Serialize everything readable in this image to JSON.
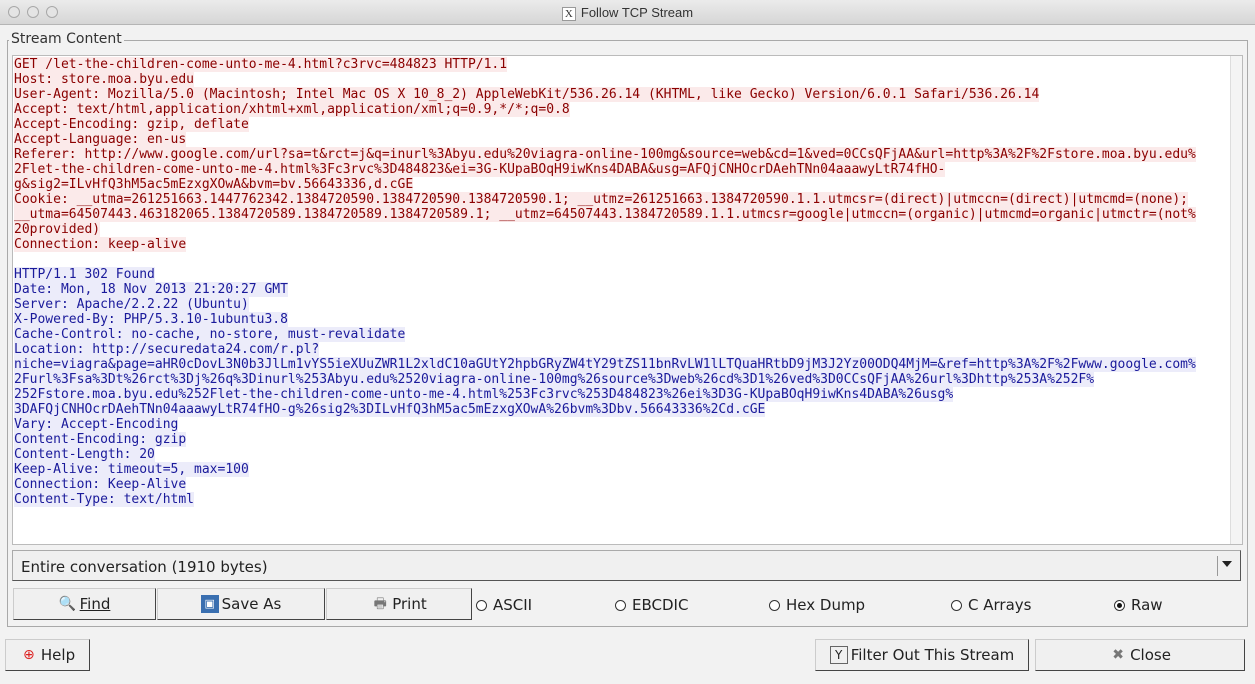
{
  "window": {
    "title": "Follow TCP Stream",
    "title_icon": "X"
  },
  "stream": {
    "label": "Stream Content",
    "request": [
      "GET /let-the-children-come-unto-me-4.html?c3rvc=484823 HTTP/1.1",
      "Host: store.moa.byu.edu",
      "User-Agent: Mozilla/5.0 (Macintosh; Intel Mac OS X 10_8_2) AppleWebKit/536.26.14 (KHTML, like Gecko) Version/6.0.1 Safari/536.26.14",
      "Accept: text/html,application/xhtml+xml,application/xml;q=0.9,*/*;q=0.8",
      "Accept-Encoding: gzip, deflate",
      "Accept-Language: en-us",
      "Referer: http://www.google.com/url?sa=t&rct=j&q=inurl%3Abyu.edu%20viagra-online-100mg&source=web&cd=1&ved=0CCsQFjAA&url=http%3A%2F%2Fstore.moa.byu.edu%",
      "2Flet-the-children-come-unto-me-4.html%3Fc3rvc%3D484823&ei=3G-KUpaBOqH9iwKns4DABA&usg=AFQjCNHOcrDAehTNn04aaawyLtR74fHO-",
      "g&sig2=ILvHfQ3hM5ac5mEzxgXOwA&bvm=bv.56643336,d.cGE",
      "Cookie: __utma=261251663.1447762342.1384720590.1384720590.1384720590.1; __utmz=261251663.1384720590.1.1.utmcsr=(direct)|utmccn=(direct)|utmcmd=(none);",
      "__utma=64507443.463182065.1384720589.1384720589.1384720589.1; __utmz=64507443.1384720589.1.1.utmcsr=google|utmccn=(organic)|utmcmd=organic|utmctr=(not%",
      "20provided)",
      "Connection: keep-alive"
    ],
    "response": [
      "HTTP/1.1 302 Found",
      "Date: Mon, 18 Nov 2013 21:20:27 GMT",
      "Server: Apache/2.2.22 (Ubuntu)",
      "X-Powered-By: PHP/5.3.10-1ubuntu3.8",
      "Cache-Control: no-cache, no-store, must-revalidate",
      "Location: http://securedata24.com/r.pl?",
      "niche=viagra&page=aHR0cDovL3N0b3JlLm1vYS5ieXUuZWR1L2xldC10aGUtY2hpbGRyZW4tY29tZS11bnRvLW1lLTQuaHRtbD9jM3J2Yz00ODQ4MjM=&ref=http%3A%2F%2Fwww.google.com%",
      "2Furl%3Fsa%3Dt%26rct%3Dj%26q%3Dinurl%253Abyu.edu%2520viagra-online-100mg%26source%3Dweb%26cd%3D1%26ved%3D0CCsQFjAA%26url%3Dhttp%253A%252F%",
      "252Fstore.moa.byu.edu%252Flet-the-children-come-unto-me-4.html%253Fc3rvc%253D484823%26ei%3D3G-KUpaBOqH9iwKns4DABA%26usg%",
      "3DAFQjCNHOcrDAehTNn04aaawyLtR74fHO-g%26sig2%3DILvHfQ3hM5ac5mEzxgXOwA%26bvm%3Dbv.56643336%2Cd.cGE",
      "Vary: Accept-Encoding",
      "Content-Encoding: gzip",
      "Content-Length: 20",
      "Keep-Alive: timeout=5, max=100",
      "Connection: Keep-Alive",
      "Content-Type: text/html"
    ]
  },
  "conversation": {
    "selected": "Entire conversation (1910 bytes)"
  },
  "buttons": {
    "find": "Find",
    "save_as": "Save As",
    "print": "Print",
    "help": "Help",
    "filter": "Filter Out This Stream",
    "close": "Close"
  },
  "formats": [
    {
      "label": "ASCII",
      "selected": false
    },
    {
      "label": "EBCDIC",
      "selected": false
    },
    {
      "label": "Hex Dump",
      "selected": false
    },
    {
      "label": "C Arrays",
      "selected": false
    },
    {
      "label": "Raw",
      "selected": true
    }
  ],
  "colors": {
    "request_fg": "#8b0000",
    "request_bg": "#fbeaea",
    "response_fg": "#1a1a9b",
    "response_bg": "#ececfa"
  }
}
